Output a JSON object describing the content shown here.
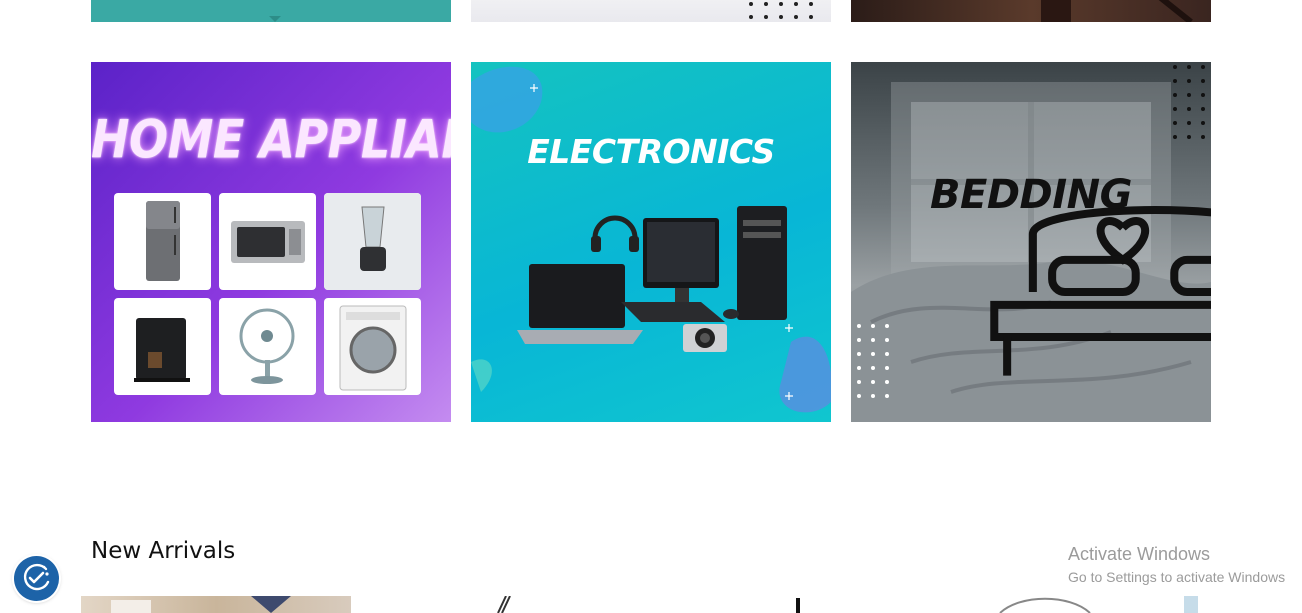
{
  "categories": [
    {
      "title": "HOME APPLIANCE"
    },
    {
      "title": "ELECTRONICS"
    },
    {
      "title": "BEDDING"
    }
  ],
  "new_arrivals": {
    "heading": "New Arrivals"
  },
  "watermark": {
    "line1": "Activate Windows",
    "line2": "Go to Settings to activate Windows"
  },
  "icons": {
    "consent": "cookie-consent-icon",
    "bed": "bed-heart-icon"
  },
  "colors": {
    "consent_button": "#1d63a8",
    "appliance_bg": "#7a2fd8",
    "electronics_bg": "#0cbccf"
  }
}
